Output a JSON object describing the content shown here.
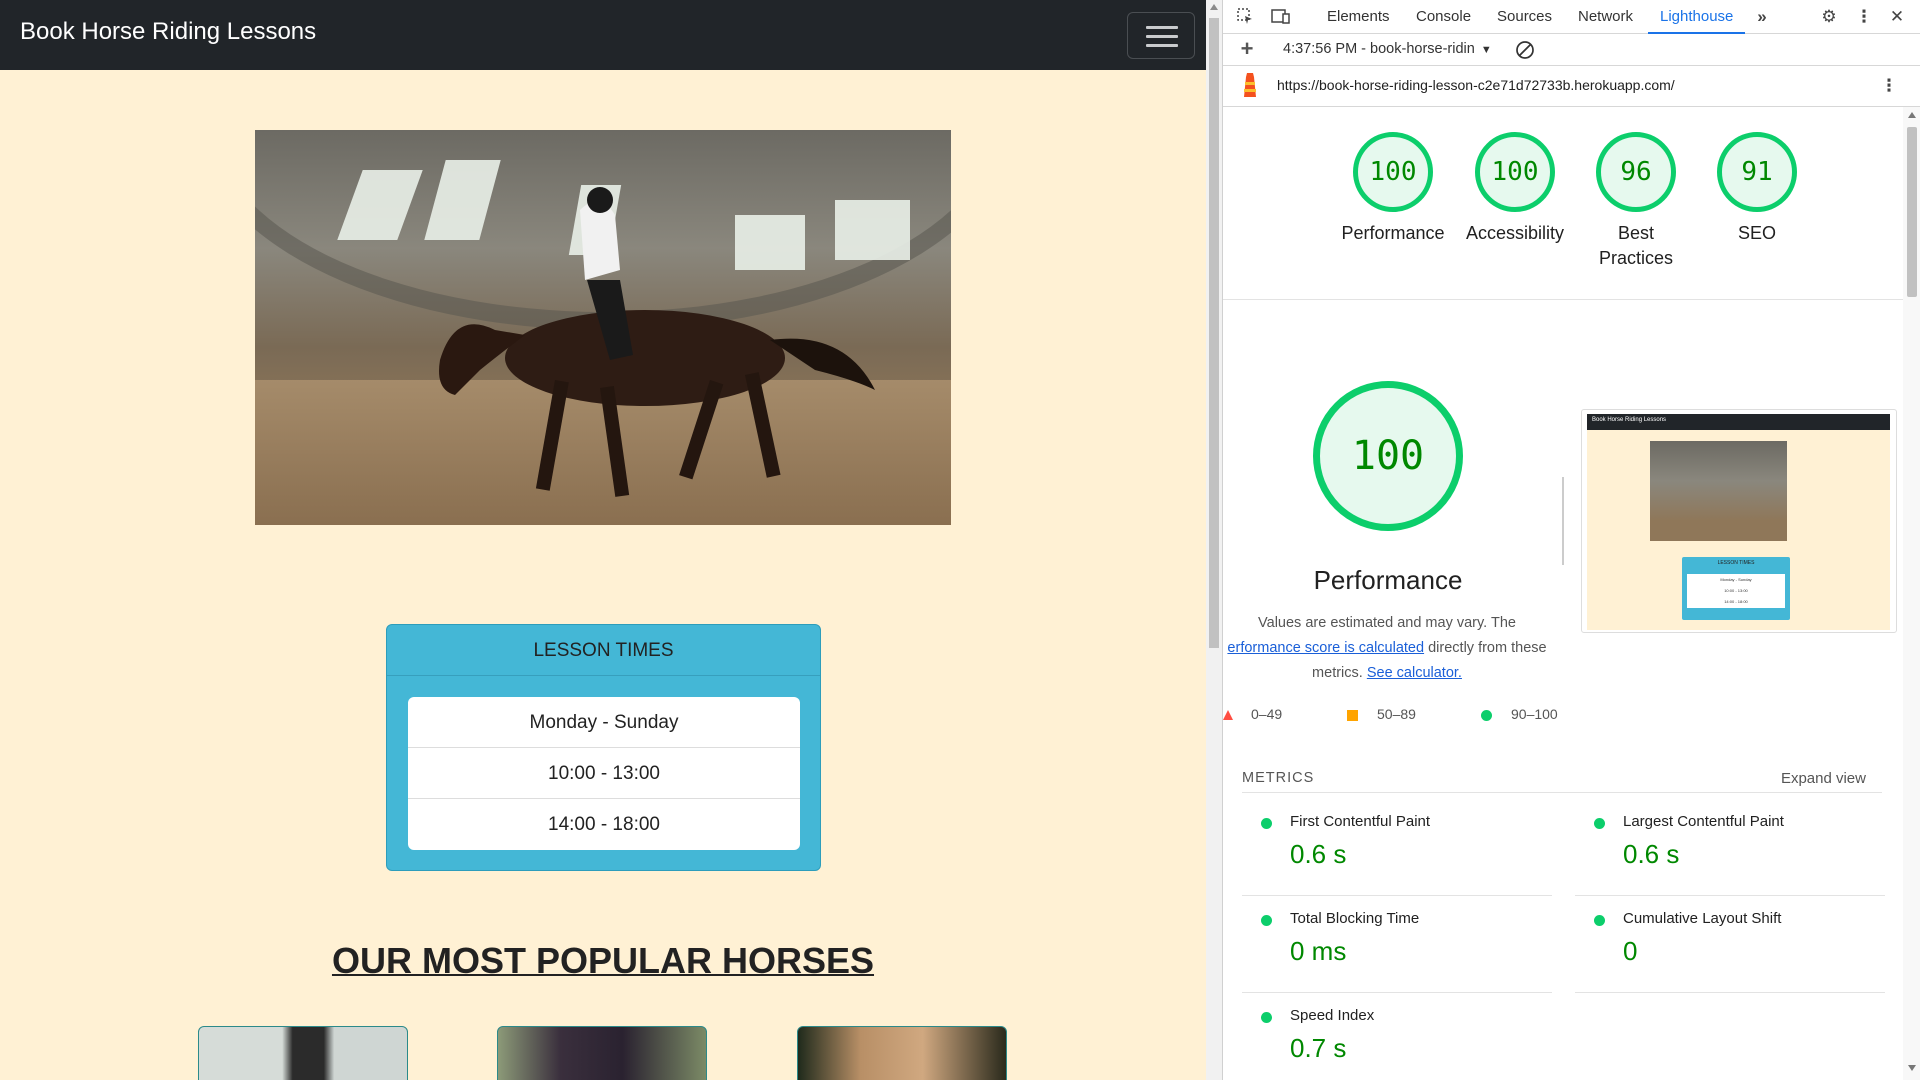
{
  "site": {
    "brand": "Book Horse Riding Lessons",
    "lesson_times": {
      "header": "LESSON TIMES",
      "items": [
        "Monday - Sunday",
        "10:00 - 13:00",
        "14:00 - 18:00"
      ]
    },
    "popular_title": "OUR MOST POPULAR HORSES"
  },
  "devtools": {
    "tabs": [
      "Elements",
      "Console",
      "Sources",
      "Network",
      "Lighthouse"
    ],
    "active_tab": "Lighthouse",
    "report_selector": "4:37:56 PM - book-horse-ridin",
    "url": "https://book-horse-riding-lesson-c2e71d72733b.herokuapp.com/",
    "scores": [
      {
        "value": "100",
        "label": "Performance"
      },
      {
        "value": "100",
        "label": "Accessibility"
      },
      {
        "value": "96",
        "label": "Best Practices"
      },
      {
        "value": "91",
        "label": "SEO"
      }
    ],
    "performance": {
      "score": "100",
      "title": "Performance",
      "desc_1": "Values are estimated and may vary. The",
      "desc_link_1": "erformance score is calculated",
      "desc_2": "directly from these metrics.",
      "desc_link_2": "See calculator."
    },
    "legend": {
      "fail": "0–49",
      "average": "50–89",
      "pass": "90–100"
    },
    "thumbnail": {
      "brand": "Book Horse Riding Lessons",
      "header": "LESSON TIMES",
      "items": [
        "Monday - Sunday",
        "10:00 - 13:00",
        "14:00 - 18:00"
      ]
    },
    "metrics_label": "METRICS",
    "expand_view": "Expand view",
    "metrics": [
      {
        "name": "First Contentful Paint",
        "value": "0.6 s"
      },
      {
        "name": "Largest Contentful Paint",
        "value": "0.6 s"
      },
      {
        "name": "Total Blocking Time",
        "value": "0 ms"
      },
      {
        "name": "Cumulative Layout Shift",
        "value": "0"
      },
      {
        "name": "Speed Index",
        "value": "0.7 s"
      }
    ],
    "colors": {
      "pass": "#0cce6b",
      "average": "#ffa400",
      "fail": "#ff4e42",
      "accent": "#1a73e8"
    }
  }
}
